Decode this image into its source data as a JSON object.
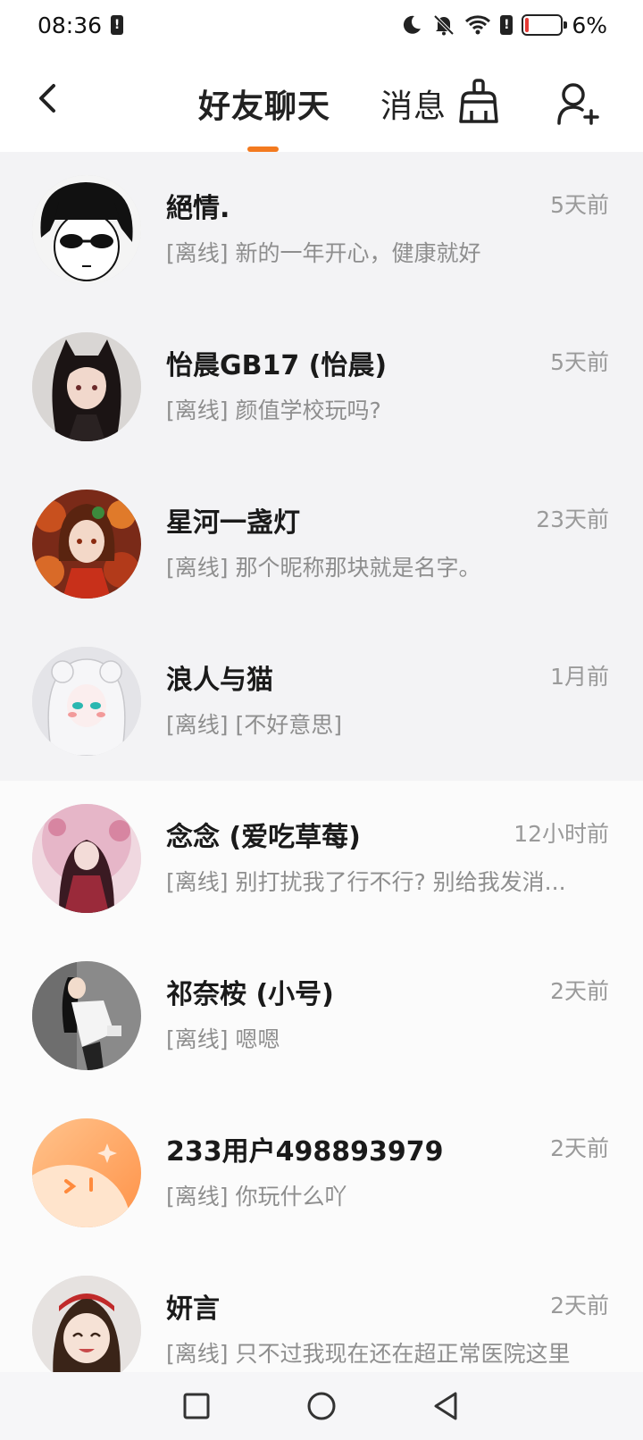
{
  "status": {
    "time": "08:36",
    "battery": "6%"
  },
  "header": {
    "title": "好友聊天",
    "messages_tab": "消息"
  },
  "chats": [
    {
      "name": "絕情.",
      "time": "5天前",
      "preview": "[离线] 新的一年开心，健康就好",
      "pinned": true
    },
    {
      "name": "怡晨GB17 (怡晨)",
      "time": "5天前",
      "preview": "[离线] 颜值学校玩吗?",
      "pinned": true
    },
    {
      "name": "星河一盏灯",
      "time": "23天前",
      "preview": "[离线] 那个昵称那块就是名字。",
      "pinned": true
    },
    {
      "name": "浪人与猫",
      "time": "1月前",
      "preview": "[离线] [不好意思]",
      "pinned": true
    },
    {
      "name": "念念 (爱吃草莓)",
      "time": "12小时前",
      "preview": "[离线] 别打扰我了行不行? 别给我发消...",
      "pinned": false
    },
    {
      "name": "祁奈桉 (小号)",
      "time": "2天前",
      "preview": "[离线] 嗯嗯",
      "pinned": false
    },
    {
      "name": "233用户498893979",
      "time": "2天前",
      "preview": "[离线] 你玩什么吖",
      "pinned": false
    },
    {
      "name": "妍言",
      "time": "2天前",
      "preview": "[离线] 只不过我现在还在超正常医院这里",
      "pinned": false
    }
  ],
  "colors": {
    "accent": "#f37a1f",
    "pinned_bg": "#f3f3f5",
    "battery_low": "#e53935"
  }
}
